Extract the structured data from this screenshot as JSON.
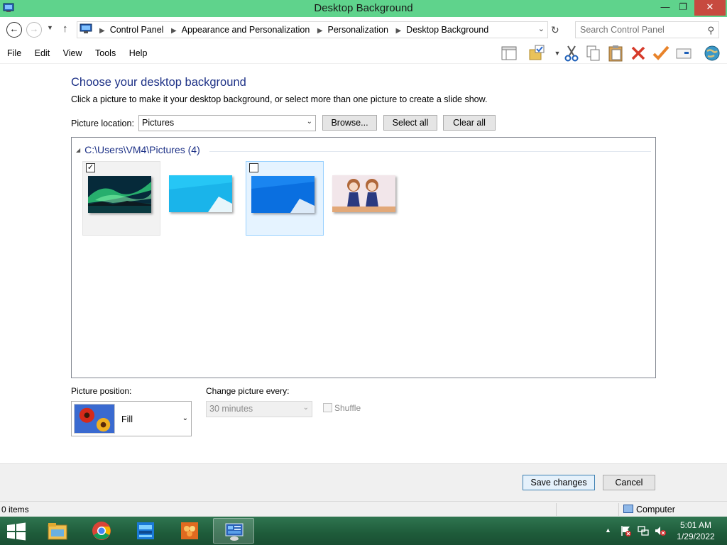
{
  "window": {
    "title": "Desktop Background",
    "close_glyph": "✕",
    "max_glyph": "❐",
    "min_glyph": "—"
  },
  "address": {
    "crumbs": [
      "Control Panel",
      "Appearance and Personalization",
      "Personalization",
      "Desktop Background"
    ],
    "search_placeholder": "Search Control Panel"
  },
  "menu": [
    "File",
    "Edit",
    "View",
    "Tools",
    "Help"
  ],
  "toolbar_icons": [
    "layout-icon",
    "folder-check-icon",
    "cut-icon",
    "copy-icon",
    "paste-icon",
    "delete-icon",
    "check-icon",
    "properties-icon",
    "globe-icon"
  ],
  "content": {
    "heading": "Choose your desktop background",
    "subtext": "Click a picture to make it your desktop background, or select more than one picture to create a slide show.",
    "location_label": "Picture location:",
    "location_value": "Pictures",
    "browse_label": "Browse...",
    "select_all_label": "Select all",
    "clear_all_label": "Clear all",
    "group_header": "C:\\Users\\VM4\\Pictures (4)",
    "thumbnails": [
      {
        "name": "aurora",
        "checked": true
      },
      {
        "name": "win8-light-blue",
        "checked": false
      },
      {
        "name": "win8-blue",
        "checked": false
      },
      {
        "name": "anime-girls",
        "checked": false
      }
    ],
    "position_label": "Picture position:",
    "position_value": "Fill",
    "change_label": "Change picture every:",
    "change_value": "30 minutes",
    "shuffle_label": "Shuffle"
  },
  "footer": {
    "save_label": "Save changes",
    "cancel_label": "Cancel"
  },
  "status": {
    "items": "0 items",
    "location": "Computer"
  },
  "taskbar": {
    "apps": [
      "file-explorer",
      "chrome",
      "desktop-app",
      "colorful-app",
      "control-panel"
    ],
    "time": "5:01 AM",
    "date": "1/29/2022"
  },
  "colors": {
    "titlebar": "#5fd38c",
    "heading": "#1e3287",
    "taskbar": "#1e5b3a",
    "close": "#c74a3f"
  }
}
